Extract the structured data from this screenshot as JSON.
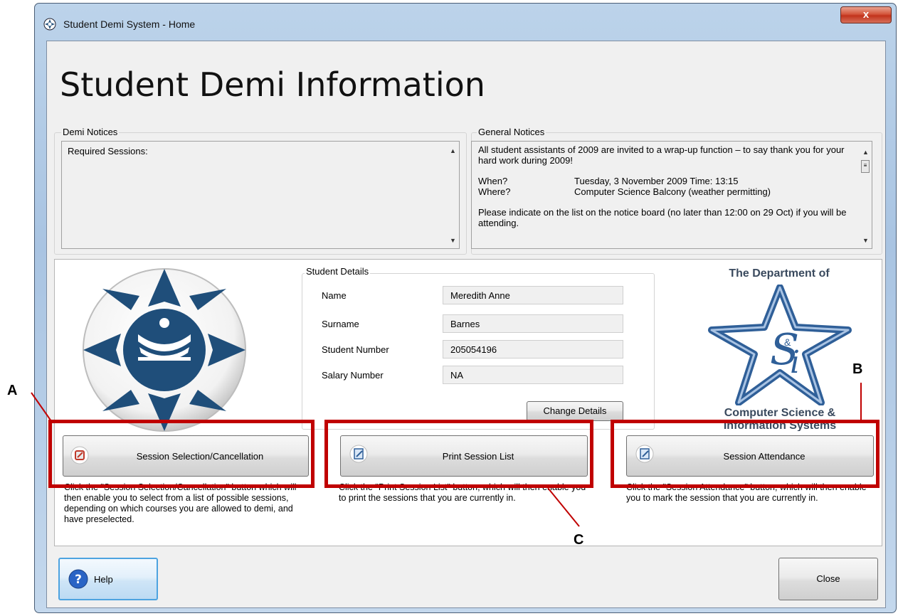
{
  "window": {
    "title": "Student Demi System - Home",
    "close_label": "x"
  },
  "page_title": "Student Demi Information",
  "demi_notices": {
    "label": "Demi Notices",
    "text": "Required Sessions:"
  },
  "general_notices": {
    "label": "General Notices",
    "line1": "All student assistants of 2009 are invited to a wrap-up function – to say thank you for your hard work during 2009!",
    "when_label": "When?",
    "when_value": "Tuesday, 3 November 2009 Time: 13:15",
    "where_label": "Where?",
    "where_value": "Computer Science Balcony (weather permitting)",
    "line3": "Please indicate on the list on the notice board (no later than 12:00 on 29 Oct) if you will be attending."
  },
  "student_details": {
    "label": "Student Details",
    "fields": [
      {
        "label": "Name",
        "value": "Meredith Anne"
      },
      {
        "label": "Surname",
        "value": "Barnes"
      },
      {
        "label": "Student Number",
        "value": "205054196"
      },
      {
        "label": "Salary Number",
        "value": "NA"
      }
    ],
    "change_button": "Change Details"
  },
  "department_logo": {
    "line1": "The Department of",
    "line2": "Computer Science &",
    "line3": "Information Systems"
  },
  "actions": [
    {
      "label": "Session Selection/Cancellation",
      "icon": "cancel-session-icon",
      "description": "Click the \"Session Selection/Cancellation\" button which will then enable you to select from a list of possible sessions, depending on which courses you are allowed to demi, and have preselected."
    },
    {
      "label": "Print Session List",
      "icon": "print-list-icon",
      "description": "Click the \"Print Session List\" button, which will then enable you to print the sessions that you are currently in."
    },
    {
      "label": "Session Attendance",
      "icon": "attendance-icon",
      "description": "Click the \"Session Attendance\" button, which will then enable you to mark the session that you are currently in."
    }
  ],
  "footer": {
    "help_label": "Help",
    "close_label": "Close"
  },
  "callouts": {
    "a": "A",
    "b": "B",
    "c": "C"
  },
  "colors": {
    "highlight": "#c00000",
    "logo_blue": "#1f4e7a"
  }
}
